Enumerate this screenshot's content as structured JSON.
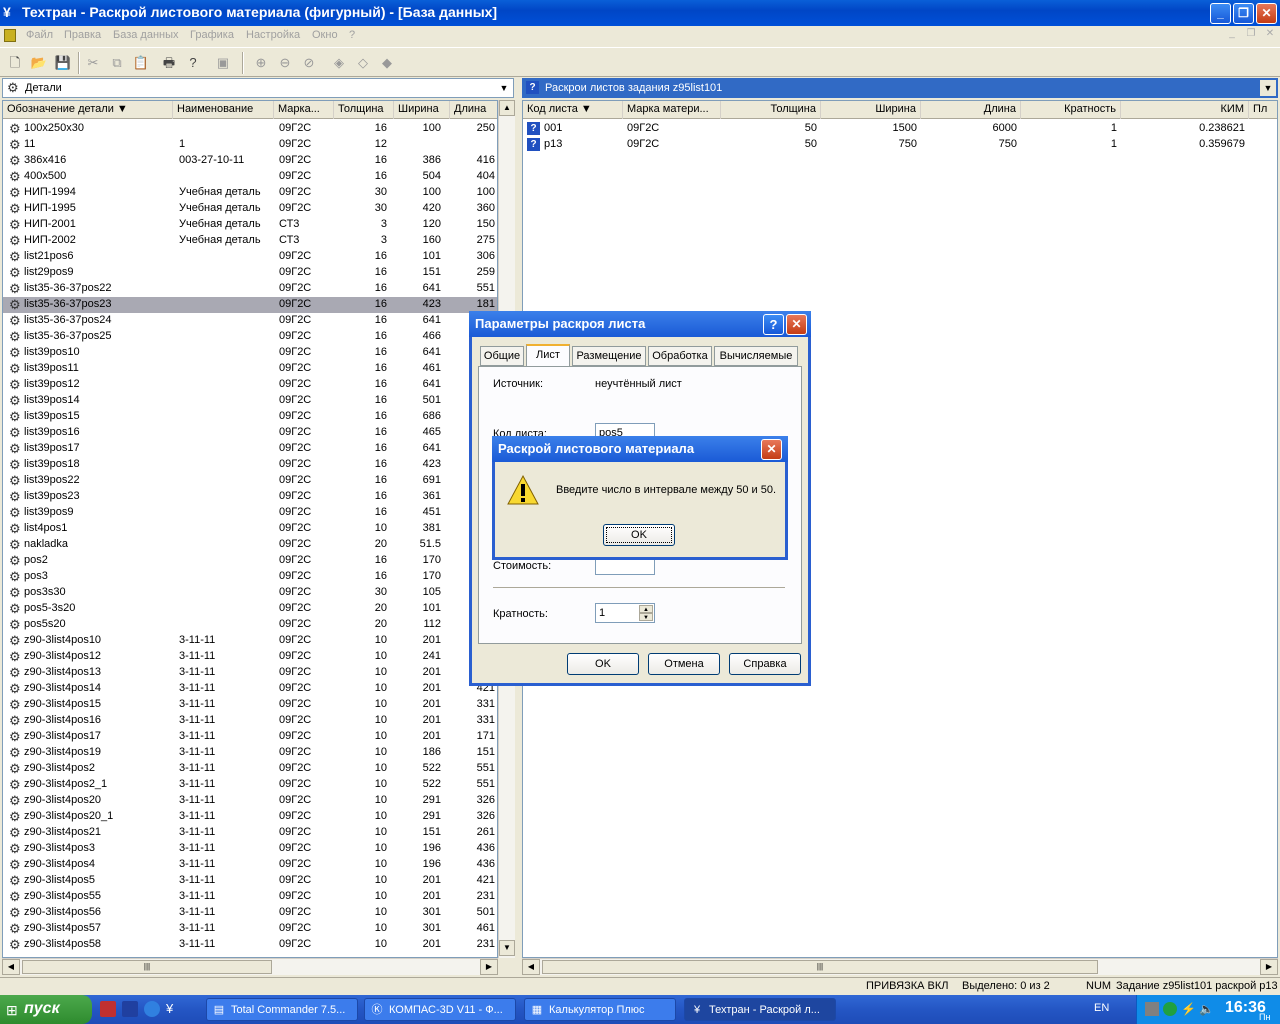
{
  "window": {
    "title": "Техтран - Раскрой листового материала (фигурный) - [База данных]"
  },
  "menu": [
    "Файл",
    "Правка",
    "База данных",
    "Графика",
    "Настройка",
    "Окно",
    "?"
  ],
  "left_panel": {
    "combo": "Детали",
    "columns": [
      "Обозначение детали",
      "Наименование",
      "Марка...",
      "Толщина",
      "Ширина",
      "Длина"
    ],
    "rows": [
      [
        "100x250x30",
        "",
        "09Г2С",
        "16",
        "100",
        "250"
      ],
      [
        "11",
        "1",
        "09Г2С",
        "12",
        "",
        ""
      ],
      [
        "386x416",
        "003-27-10-11",
        "09Г2С",
        "16",
        "386",
        "416"
      ],
      [
        "400x500",
        "",
        "09Г2С",
        "16",
        "504",
        "404"
      ],
      [
        "НИП-1994",
        "Учебная деталь",
        "09Г2С",
        "30",
        "100",
        "100"
      ],
      [
        "НИП-1995",
        "Учебная деталь",
        "09Г2С",
        "30",
        "420",
        "360"
      ],
      [
        "НИП-2001",
        "Учебная деталь",
        "СТ3",
        "3",
        "120",
        "150"
      ],
      [
        "НИП-2002",
        "Учебная деталь",
        "СТ3",
        "3",
        "160",
        "275"
      ],
      [
        "list21pos6",
        "",
        "09Г2С",
        "16",
        "101",
        "306"
      ],
      [
        "list29pos9",
        "",
        "09Г2С",
        "16",
        "151",
        "259"
      ],
      [
        "list35-36-37pos22",
        "",
        "09Г2С",
        "16",
        "641",
        "551"
      ],
      [
        "list35-36-37pos23",
        "",
        "09Г2С",
        "16",
        "423",
        "181"
      ],
      [
        "list35-36-37pos24",
        "",
        "09Г2С",
        "16",
        "641",
        ""
      ],
      [
        "list35-36-37pos25",
        "",
        "09Г2С",
        "16",
        "466",
        ""
      ],
      [
        "list39pos10",
        "",
        "09Г2С",
        "16",
        "641",
        "1"
      ],
      [
        "list39pos11",
        "",
        "09Г2С",
        "16",
        "461",
        ""
      ],
      [
        "list39pos12",
        "",
        "09Г2С",
        "16",
        "641",
        "1"
      ],
      [
        "list39pos14",
        "",
        "09Г2С",
        "16",
        "501",
        ""
      ],
      [
        "list39pos15",
        "",
        "09Г2С",
        "16",
        "686",
        ""
      ],
      [
        "list39pos16",
        "",
        "09Г2С",
        "16",
        "465",
        ""
      ],
      [
        "list39pos17",
        "",
        "09Г2С",
        "16",
        "641",
        ""
      ],
      [
        "list39pos18",
        "",
        "09Г2С",
        "16",
        "423",
        ""
      ],
      [
        "list39pos22",
        "",
        "09Г2С",
        "16",
        "691",
        "1"
      ],
      [
        "list39pos23",
        "",
        "09Г2С",
        "16",
        "361",
        ""
      ],
      [
        "list39pos9",
        "",
        "09Г2С",
        "16",
        "451",
        "1"
      ],
      [
        "list4pos1",
        "",
        "09Г2С",
        "10",
        "381",
        ""
      ],
      [
        "nakladka",
        "",
        "09Г2С",
        "20",
        "51.5",
        ""
      ],
      [
        "pos2",
        "",
        "09Г2С",
        "16",
        "170",
        ""
      ],
      [
        "pos3",
        "",
        "09Г2С",
        "16",
        "170",
        ""
      ],
      [
        "pos3s30",
        "",
        "09Г2С",
        "30",
        "105",
        ""
      ],
      [
        "pos5-3s20",
        "",
        "09Г2С",
        "20",
        "101",
        ""
      ],
      [
        "pos5s20",
        "",
        "09Г2С",
        "20",
        "112",
        ""
      ],
      [
        "z90-3list4pos10",
        "3-11-11",
        "09Г2С",
        "10",
        "201",
        ""
      ],
      [
        "z90-3list4pos12",
        "3-11-11",
        "09Г2С",
        "10",
        "241",
        ""
      ],
      [
        "z90-3list4pos13",
        "3-11-11",
        "09Г2С",
        "10",
        "201",
        ""
      ],
      [
        "z90-3list4pos14",
        "3-11-11",
        "09Г2С",
        "10",
        "201",
        "421"
      ],
      [
        "z90-3list4pos15",
        "3-11-11",
        "09Г2С",
        "10",
        "201",
        "331"
      ],
      [
        "z90-3list4pos16",
        "3-11-11",
        "09Г2С",
        "10",
        "201",
        "331"
      ],
      [
        "z90-3list4pos17",
        "3-11-11",
        "09Г2С",
        "10",
        "201",
        "171"
      ],
      [
        "z90-3list4pos19",
        "3-11-11",
        "09Г2С",
        "10",
        "186",
        "151"
      ],
      [
        "z90-3list4pos2",
        "3-11-11",
        "09Г2С",
        "10",
        "522",
        "551"
      ],
      [
        "z90-3list4pos2_1",
        "3-11-11",
        "09Г2С",
        "10",
        "522",
        "551"
      ],
      [
        "z90-3list4pos20",
        "3-11-11",
        "09Г2С",
        "10",
        "291",
        "326"
      ],
      [
        "z90-3list4pos20_1",
        "3-11-11",
        "09Г2С",
        "10",
        "291",
        "326"
      ],
      [
        "z90-3list4pos21",
        "3-11-11",
        "09Г2С",
        "10",
        "151",
        "261"
      ],
      [
        "z90-3list4pos3",
        "3-11-11",
        "09Г2С",
        "10",
        "196",
        "436"
      ],
      [
        "z90-3list4pos4",
        "3-11-11",
        "09Г2С",
        "10",
        "196",
        "436"
      ],
      [
        "z90-3list4pos5",
        "3-11-11",
        "09Г2С",
        "10",
        "201",
        "421"
      ],
      [
        "z90-3list4pos55",
        "3-11-11",
        "09Г2С",
        "10",
        "201",
        "231"
      ],
      [
        "z90-3list4pos56",
        "3-11-11",
        "09Г2С",
        "10",
        "301",
        "501"
      ],
      [
        "z90-3list4pos57",
        "3-11-11",
        "09Г2С",
        "10",
        "301",
        "461"
      ],
      [
        "z90-3list4pos58",
        "3-11-11",
        "09Г2С",
        "10",
        "201",
        "231"
      ]
    ]
  },
  "right_panel": {
    "combo": "Раскрои листов задания z95list101",
    "columns": [
      "Код листа",
      "Марка матери...",
      "Толщина",
      "Ширина",
      "Длина",
      "Кратность",
      "КИМ",
      "Пл"
    ],
    "rows": [
      [
        "001",
        "09Г2С",
        "50",
        "1500",
        "6000",
        "1",
        "0.238621"
      ],
      [
        "p13",
        "09Г2С",
        "50",
        "750",
        "750",
        "1",
        "0.359679"
      ]
    ]
  },
  "params_dialog": {
    "title": "Параметры раскроя листа",
    "tabs": [
      "Общие",
      "Лист",
      "Размещение",
      "Обработка",
      "Вычисляемые"
    ],
    "source_label": "Источник:",
    "source_value": "неучтённый лист",
    "code_label": "Код листа:",
    "code_value": "pos5",
    "cost_label": "Стоимость:",
    "mult_label": "Кратность:",
    "mult_value": "1",
    "ok": "OK",
    "cancel": "Отмена",
    "help": "Справка"
  },
  "alert": {
    "title": "Раскрой листового материала",
    "message": "Введите число в интервале между 50 и 50.",
    "ok": "OK"
  },
  "status": {
    "snap": "ПРИВЯЗКА ВКЛ",
    "selected": "Выделено: 0 из 2",
    "num": "NUM",
    "task": "Задание z95list101 раскрой p13"
  },
  "taskbar": {
    "start": "пуск",
    "items": [
      "Total Commander 7.5...",
      "КОМПАС-3D V11 - Ф...",
      "Калькулятор Плюс",
      "Техтран - Раскрой л..."
    ],
    "lang": "EN",
    "time": "16:36",
    "day": "Пн"
  }
}
